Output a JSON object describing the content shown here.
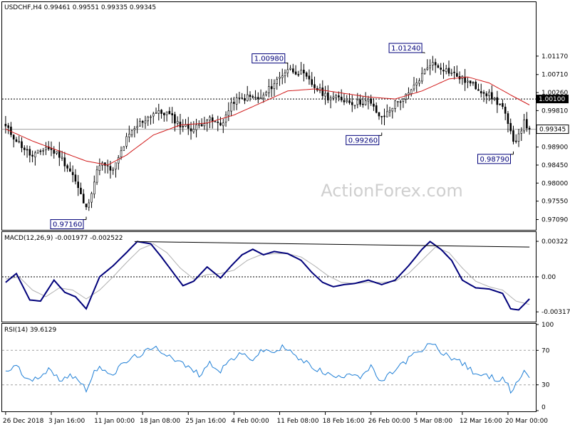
{
  "chart_data": [
    {
      "type": "candlestick",
      "panel": "price",
      "title": "USDCHF,H4  0.99461 0.99551 0.99335 0.99345",
      "watermark": "ActionForex.com",
      "ylim": [
        0.9685,
        1.025
      ],
      "y_ticks": [
        "1.01170",
        "1.00710",
        "1.00260",
        "0.99810",
        "0.99345",
        "0.98900",
        "0.98450",
        "0.98000",
        "0.97550",
        "0.97090"
      ],
      "tick_values": [
        1.0117,
        1.0071,
        1.0026,
        0.9981,
        0.99345,
        0.989,
        0.9845,
        0.98,
        0.9755,
        0.9709
      ],
      "current_price": {
        "value": 0.99345,
        "label": "0.99345"
      },
      "level_line": {
        "value": 1.001,
        "label": "1.00100"
      },
      "annotations": [
        {
          "label": "0.97160",
          "value": 0.9716,
          "x_index": 30
        },
        {
          "label": "1.00980",
          "value": 1.0098,
          "x_index": 105
        },
        {
          "label": "0.99260",
          "value": 0.9926,
          "x_index": 140
        },
        {
          "label": "1.01240",
          "value": 1.0124,
          "x_index": 156
        },
        {
          "label": "0.98790",
          "value": 0.9879,
          "x_index": 189
        }
      ],
      "anchors": [
        [
          0,
          0.994
        ],
        [
          5,
          0.99
        ],
        [
          10,
          0.9865
        ],
        [
          15,
          0.989
        ],
        [
          20,
          0.987
        ],
        [
          25,
          0.982
        ],
        [
          30,
          0.9735
        ],
        [
          35,
          0.985
        ],
        [
          40,
          0.983
        ],
        [
          45,
          0.991
        ],
        [
          50,
          0.995
        ],
        [
          55,
          0.9975
        ],
        [
          60,
          0.9975
        ],
        [
          65,
          0.9945
        ],
        [
          70,
          0.9935
        ],
        [
          75,
          0.996
        ],
        [
          80,
          0.9945
        ],
        [
          85,
          1.0005
        ],
        [
          90,
          1.0015
        ],
        [
          95,
          1.001
        ],
        [
          100,
          1.005
        ],
        [
          105,
          1.0085
        ],
        [
          110,
          1.0075
        ],
        [
          115,
          1.004
        ],
        [
          120,
          1.0015
        ],
        [
          125,
          1.001
        ],
        [
          130,
          1.0
        ],
        [
          135,
          1.0005
        ],
        [
          140,
          0.996
        ],
        [
          145,
          1.0
        ],
        [
          150,
          1.002
        ],
        [
          155,
          1.007
        ],
        [
          158,
          1.01
        ],
        [
          162,
          1.009
        ],
        [
          166,
          1.0075
        ],
        [
          170,
          1.006
        ],
        [
          175,
          1.004
        ],
        [
          180,
          1.002
        ],
        [
          185,
          0.999
        ],
        [
          189,
          0.99
        ],
        [
          193,
          0.995
        ],
        [
          195,
          0.99345
        ]
      ],
      "moving_average_anchors": [
        [
          0,
          0.9935
        ],
        [
          10,
          0.9905
        ],
        [
          20,
          0.988
        ],
        [
          30,
          0.9855
        ],
        [
          38,
          0.9845
        ],
        [
          45,
          0.987
        ],
        [
          55,
          0.992
        ],
        [
          65,
          0.9945
        ],
        [
          75,
          0.995
        ],
        [
          85,
          0.997
        ],
        [
          95,
          1.0
        ],
        [
          105,
          1.003
        ],
        [
          115,
          1.0035
        ],
        [
          125,
          1.0025
        ],
        [
          135,
          1.0015
        ],
        [
          145,
          1.001
        ],
        [
          155,
          1.003
        ],
        [
          165,
          1.006
        ],
        [
          172,
          1.0065
        ],
        [
          180,
          1.005
        ],
        [
          188,
          1.002
        ],
        [
          195,
          0.9995
        ]
      ],
      "colors": {
        "candles": "#000000",
        "moving_average": "#d11a1a",
        "level_line": "#000000"
      }
    },
    {
      "type": "line",
      "panel": "macd",
      "title": "MACD(12,26,9) -0.001977 -0.002522",
      "ylim": [
        -0.004,
        0.004
      ],
      "y_ticks": [
        "0.00322",
        "0.00",
        "-0.003174"
      ],
      "tick_values": [
        0.00322,
        0.0,
        -0.003174
      ],
      "series": [
        {
          "name": "MACD",
          "color": "#00007a",
          "anchors": [
            [
              0,
              -0.0005
            ],
            [
              4,
              0.0003
            ],
            [
              9,
              -0.0021
            ],
            [
              13,
              -0.0022
            ],
            [
              18,
              -0.0003
            ],
            [
              22,
              -0.0014
            ],
            [
              26,
              -0.0018
            ],
            [
              30,
              -0.0029
            ],
            [
              35,
              0.0
            ],
            [
              40,
              0.001
            ],
            [
              45,
              0.0022
            ],
            [
              49,
              0.0032
            ],
            [
              54,
              0.003
            ],
            [
              58,
              0.0018
            ],
            [
              62,
              0.0005
            ],
            [
              66,
              -0.0008
            ],
            [
              70,
              -0.0004
            ],
            [
              75,
              0.0009
            ],
            [
              80,
              -0.0001
            ],
            [
              84,
              0.001
            ],
            [
              88,
              0.002
            ],
            [
              92,
              0.0025
            ],
            [
              96,
              0.002
            ],
            [
              100,
              0.0023
            ],
            [
              105,
              0.0021
            ],
            [
              110,
              0.0015
            ],
            [
              114,
              0.0004
            ],
            [
              118,
              -0.0005
            ],
            [
              122,
              -0.0009
            ],
            [
              126,
              -0.0007
            ],
            [
              130,
              -0.0006
            ],
            [
              135,
              -0.0003
            ],
            [
              140,
              -0.0007
            ],
            [
              145,
              -0.0003
            ],
            [
              150,
              0.001
            ],
            [
              155,
              0.0025
            ],
            [
              158,
              0.0032
            ],
            [
              162,
              0.0025
            ],
            [
              166,
              0.0015
            ],
            [
              170,
              -0.0003
            ],
            [
              175,
              -0.001
            ],
            [
              180,
              -0.0011
            ],
            [
              185,
              -0.0015
            ],
            [
              188,
              -0.0029
            ],
            [
              191,
              -0.003
            ],
            [
              195,
              -0.002
            ]
          ]
        },
        {
          "name": "Signal",
          "color": "#b0b0b0",
          "anchors": [
            [
              0,
              -0.0002
            ],
            [
              5,
              0.0
            ],
            [
              10,
              -0.0012
            ],
            [
              15,
              -0.0018
            ],
            [
              20,
              -0.001
            ],
            [
              25,
              -0.0012
            ],
            [
              30,
              -0.002
            ],
            [
              35,
              -0.0012
            ],
            [
              40,
              0.0
            ],
            [
              45,
              0.0013
            ],
            [
              50,
              0.0025
            ],
            [
              55,
              0.003
            ],
            [
              60,
              0.0022
            ],
            [
              65,
              0.0008
            ],
            [
              70,
              -0.0002
            ],
            [
              75,
              0.0002
            ],
            [
              80,
              0.0003
            ],
            [
              85,
              0.0006
            ],
            [
              90,
              0.0015
            ],
            [
              95,
              0.002
            ],
            [
              100,
              0.0021
            ],
            [
              105,
              0.0021
            ],
            [
              110,
              0.0018
            ],
            [
              115,
              0.001
            ],
            [
              120,
              0.0001
            ],
            [
              125,
              -0.0005
            ],
            [
              130,
              -0.0006
            ],
            [
              135,
              -0.0005
            ],
            [
              140,
              -0.0005
            ],
            [
              145,
              -0.0004
            ],
            [
              150,
              0.0003
            ],
            [
              155,
              0.0015
            ],
            [
              160,
              0.0027
            ],
            [
              165,
              0.0022
            ],
            [
              170,
              0.0008
            ],
            [
              175,
              -0.0004
            ],
            [
              180,
              -0.0009
            ],
            [
              185,
              -0.0012
            ],
            [
              190,
              -0.0022
            ],
            [
              195,
              -0.0025
            ]
          ]
        }
      ],
      "trendline": {
        "from": [
          48,
          0.0032
        ],
        "to": [
          195,
          0.0027
        ],
        "color": "#000000"
      }
    },
    {
      "type": "line",
      "panel": "rsi",
      "title": "RSI(14) 39.6129",
      "ylim": [
        0,
        100
      ],
      "y_ticks": [
        "100",
        "70",
        "30",
        "0"
      ],
      "tick_values": [
        100,
        70,
        30,
        0
      ],
      "guides": [
        70,
        30
      ],
      "series": [
        {
          "name": "RSI",
          "color": "#1f7fd6",
          "anchors": [
            [
              0,
              45
            ],
            [
              4,
              52
            ],
            [
              8,
              35
            ],
            [
              12,
              40
            ],
            [
              16,
              47
            ],
            [
              20,
              36
            ],
            [
              24,
              42
            ],
            [
              28,
              33
            ],
            [
              30,
              25
            ],
            [
              33,
              45
            ],
            [
              36,
              50
            ],
            [
              40,
              42
            ],
            [
              44,
              55
            ],
            [
              48,
              62
            ],
            [
              52,
              68
            ],
            [
              56,
              72
            ],
            [
              60,
              66
            ],
            [
              64,
              58
            ],
            [
              68,
              50
            ],
            [
              72,
              42
            ],
            [
              76,
              55
            ],
            [
              80,
              47
            ],
            [
              84,
              60
            ],
            [
              88,
              65
            ],
            [
              92,
              60
            ],
            [
              96,
              70
            ],
            [
              100,
              68
            ],
            [
              104,
              75
            ],
            [
              108,
              62
            ],
            [
              112,
              55
            ],
            [
              116,
              48
            ],
            [
              120,
              42
            ],
            [
              124,
              38
            ],
            [
              128,
              45
            ],
            [
              132,
              40
            ],
            [
              136,
              50
            ],
            [
              140,
              32
            ],
            [
              144,
              45
            ],
            [
              148,
              55
            ],
            [
              152,
              65
            ],
            [
              156,
              70
            ],
            [
              158,
              80
            ],
            [
              162,
              68
            ],
            [
              166,
              62
            ],
            [
              170,
              55
            ],
            [
              174,
              45
            ],
            [
              178,
              40
            ],
            [
              182,
              38
            ],
            [
              186,
              35
            ],
            [
              188,
              22
            ],
            [
              191,
              36
            ],
            [
              193,
              45
            ],
            [
              195,
              40
            ]
          ]
        }
      ]
    },
    {
      "type": "axis",
      "panel": "time",
      "x_tick_labels": [
        {
          "label": "26 Dec 2018",
          "x_index": 0
        },
        {
          "label": "3 Jan 16:00",
          "x_index": 17
        },
        {
          "label": "11 Jan 00:00",
          "x_index": 34
        },
        {
          "label": "18 Jan 08:00",
          "x_index": 51
        },
        {
          "label": "25 Jan 16:00",
          "x_index": 68
        },
        {
          "label": "4 Feb 00:00",
          "x_index": 85
        },
        {
          "label": "11 Feb 08:00",
          "x_index": 102
        },
        {
          "label": "18 Feb 16:00",
          "x_index": 119
        },
        {
          "label": "26 Feb 00:00",
          "x_index": 136
        },
        {
          "label": "5 Mar 08:00",
          "x_index": 153
        },
        {
          "label": "12 Mar 16:00",
          "x_index": 170
        },
        {
          "label": "20 Mar 00:00",
          "x_index": 187
        }
      ],
      "bar_count": 196
    }
  ]
}
